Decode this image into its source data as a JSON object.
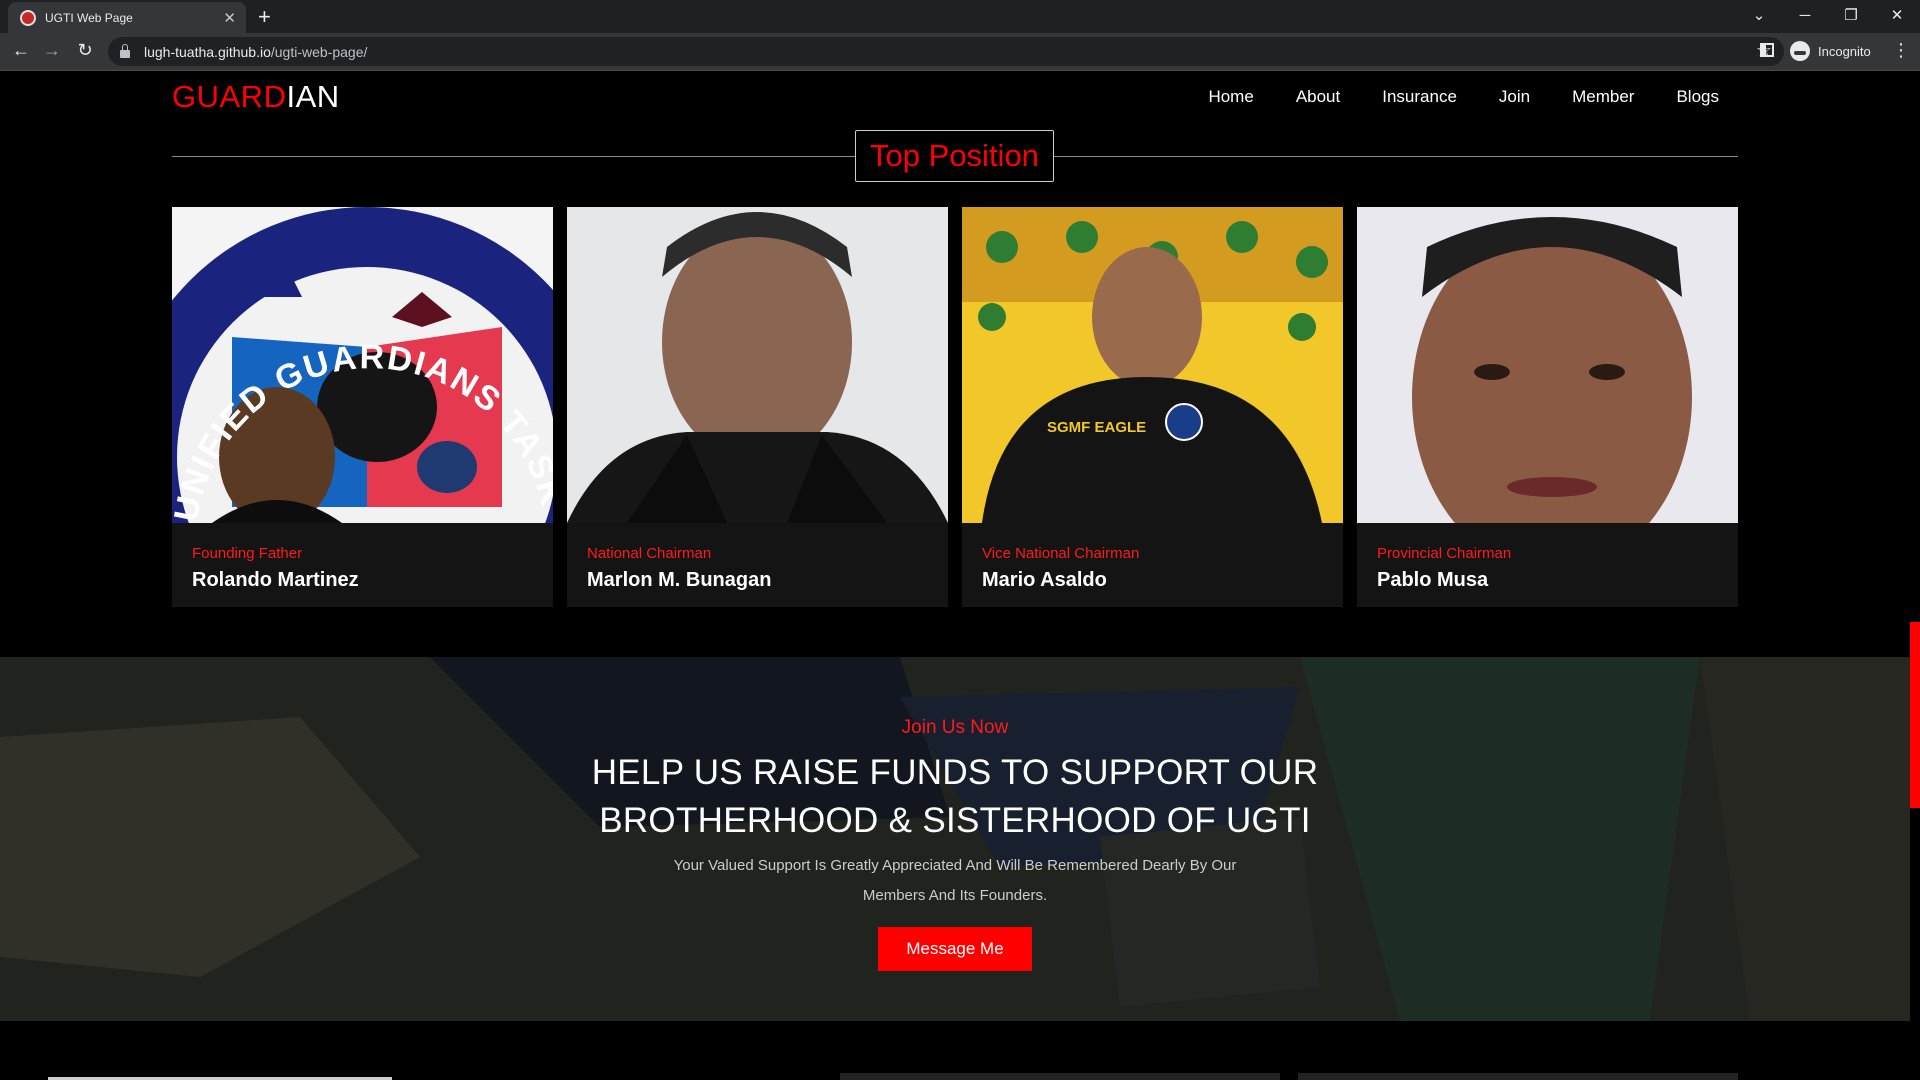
{
  "browser": {
    "tab_title": "UGTI Web Page",
    "url_host": "lugh-tuatha.github.io",
    "url_path": "/ugti-web-page/",
    "profile_label": "Incognito"
  },
  "site": {
    "logo_red": "GUARD",
    "logo_white": "IAN",
    "nav": [
      "Home",
      "About",
      "Insurance",
      "Join",
      "Member",
      "Blogs"
    ]
  },
  "section": {
    "title": "Top Position"
  },
  "cards": [
    {
      "role": "Founding Father",
      "name": "Rolando Martinez",
      "seal_text": "UNIFIED GUARDIANS TASKFORCE INC."
    },
    {
      "role": "National Chairman",
      "name": "Marlon M. Bunagan"
    },
    {
      "role": "Vice National Chairman",
      "name": "Mario Asaldo",
      "shirt_text": "SGMF EAGLE"
    },
    {
      "role": "Provincial Chairman",
      "name": "Pablo Musa"
    }
  ],
  "banner": {
    "label": "Join Us Now",
    "headline_line1": "HELP US RAISE FUNDS TO SUPPORT OUR",
    "headline_line2": "BROTHERHOOD & SISTERHOOD OF UGTI",
    "subtext": "Your Valued Support Is Greatly Appreciated And Will Be Remembered Dearly By Our Members And Its Founders.",
    "button": "Message Me"
  },
  "colors": {
    "accent": "#ff0000",
    "background": "#000000",
    "card_bg": "#141414"
  }
}
